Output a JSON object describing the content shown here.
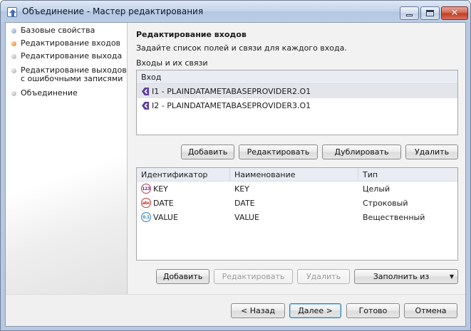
{
  "window": {
    "title": "Объединение - Мастер редактирования"
  },
  "steps": [
    {
      "label": "Базовые свойства",
      "state": "done"
    },
    {
      "label": "Редактирование входов",
      "state": "active"
    },
    {
      "label": "Редактирование выхода",
      "state": "todo"
    },
    {
      "label_line1": "Редактирование выходов",
      "label_line2": "с ошибочными записями",
      "state": "todo"
    },
    {
      "label": "Объединение",
      "state": "todo"
    }
  ],
  "main": {
    "title": "Редактирование входов",
    "subtitle": "Задайте список полей и связи для каждого входа.",
    "group_label": "Входы и их связи",
    "inputs_header": "Вход",
    "inputs": [
      {
        "label": "I1 - PLAINDATAMETABASEPROVIDER2.O1",
        "selected": true
      },
      {
        "label": "I2 - PLAINDATAMETABASEPROVIDER3.O1",
        "selected": false
      }
    ],
    "input_buttons": {
      "add": "Добавить",
      "edit": "Редактировать",
      "duplicate": "Дублировать",
      "delete": "Удалить"
    },
    "fields_columns": [
      "Идентификатор",
      "Наименование",
      "Тип"
    ],
    "fields": [
      {
        "id": "KEY",
        "name": "KEY",
        "type": "Целый",
        "icon": "integer-type-icon",
        "icon_text": "123"
      },
      {
        "id": "DATE",
        "name": "DATE",
        "type": "Строковый",
        "icon": "string-type-icon",
        "icon_text": "abc"
      },
      {
        "id": "VALUE",
        "name": "VALUE",
        "type": "Вещественный",
        "icon": "double-type-icon",
        "icon_text": "0.1"
      }
    ],
    "field_buttons": {
      "add": "Добавить",
      "edit": "Редактировать",
      "delete": "Удалить",
      "fill_from": "Заполнить из"
    }
  },
  "footer": {
    "back": "< Назад",
    "next": "Далее >",
    "finish": "Готово",
    "cancel": "Отмена"
  },
  "colors": {
    "active_step": "#e07a1a",
    "selected_row": "#e3e5eb",
    "input_tag": "#5a3d9e"
  }
}
